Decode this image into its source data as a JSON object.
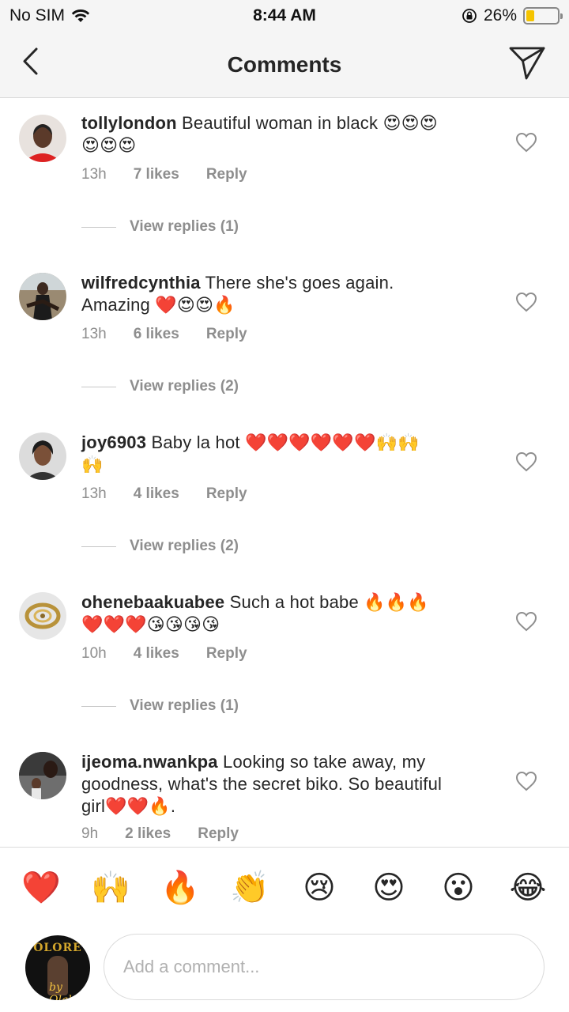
{
  "status_bar": {
    "carrier": "No SIM",
    "time": "8:44 AM",
    "battery": "26%",
    "battery_level": 0.26,
    "battery_color": "#f5c400"
  },
  "header": {
    "title": "Comments",
    "back_icon": "chevron-left-icon",
    "send_icon": "paper-plane-icon"
  },
  "comments": [
    {
      "username": "tollylondon",
      "line1": " Beautiful woman in black 😍😍😍",
      "line2": "😍😍😍",
      "time": "13h",
      "likes": "7 likes",
      "reply": "Reply",
      "view_replies": "View replies (1)"
    },
    {
      "username": "wilfredcynthia",
      "line1": " There she's goes again.",
      "line2": "Amazing ❤️😍😍🔥",
      "time": "13h",
      "likes": "6 likes",
      "reply": "Reply",
      "view_replies": "View replies (2)"
    },
    {
      "username": "joy6903",
      "line1": " Baby la hot ❤️❤️❤️❤️❤️❤️🙌🙌",
      "line2": "🙌",
      "time": "13h",
      "likes": "4 likes",
      "reply": "Reply",
      "view_replies": "View replies (2)"
    },
    {
      "username": "ohenebaakuabee",
      "line1": " Such a hot babe 🔥🔥🔥",
      "line2": "❤️❤️❤️😘😘😘😘",
      "time": "10h",
      "likes": "4 likes",
      "reply": "Reply",
      "view_replies": "View replies (1)"
    },
    {
      "username": "ijeoma.nwankpa",
      "line1": " Looking so take away, my",
      "line2": "goodness, what's the secret biko. So beautiful",
      "line3": "girl❤️❤️🔥.",
      "time": "9h",
      "likes": "2 likes",
      "reply": "Reply"
    }
  ],
  "reactions": [
    "❤️",
    "🙌",
    "🔥",
    "👏",
    "😢",
    "😍",
    "😮",
    "😂"
  ],
  "composer": {
    "placeholder": "Add a comment...",
    "avatar_text": "OLORE",
    "avatar_signature": "by Olakesi"
  }
}
